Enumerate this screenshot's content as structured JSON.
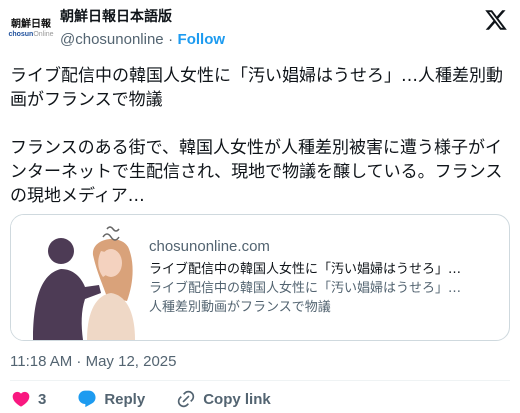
{
  "account": {
    "display_name": "朝鮮日報日本語版",
    "handle": "@chosunonline",
    "separator": "·",
    "follow_label": "Follow",
    "logo_main": "朝鮮日報",
    "logo_sub_brand": "chosun",
    "logo_sub_suffix": "Online"
  },
  "tweet": {
    "text": "ライブ配信中の韓国人女性に「汚い娼婦はうせろ」…人種差別動画がフランスで物議\n\nフランスのある街で、韓国人女性が人種差別被害に遭う様子がインターネットで生配信され、現地で物議を醸している。フランスの現地メディア…",
    "timestamp": "11:18 AM · May 12, 2025"
  },
  "card": {
    "domain": "chosunonline.com",
    "title": "ライブ配信中の韓国人女性に「汚い娼婦はうせろ」…",
    "description_line1": "ライブ配信中の韓国人女性に「汚い娼婦はうせろ」…",
    "description_line2": "人種差別動画がフランスで物議"
  },
  "actions": {
    "like_count": "3",
    "reply_label": "Reply",
    "copy_label": "Copy link"
  },
  "colors": {
    "accent": "#1d9bf0",
    "like": "#f91880",
    "secondary_text": "#536471",
    "border": "#cfd9de"
  },
  "icons": {
    "brand": "x-logo-icon",
    "like": "heart-icon",
    "reply": "speech-bubble-icon",
    "copy": "link-icon"
  }
}
